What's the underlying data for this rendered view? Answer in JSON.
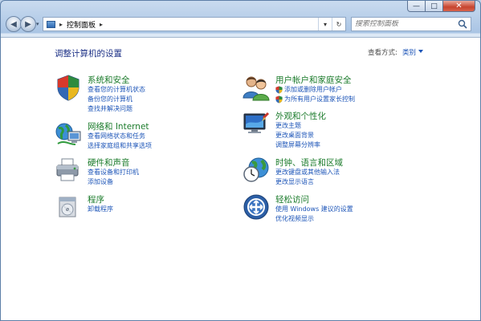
{
  "window": {
    "caption": {
      "minimize": "—",
      "maximize": "□",
      "close": "✕"
    }
  },
  "nav": {
    "back": "◀",
    "forward": "▶",
    "address_sep1": "▸",
    "address_text": "控制面板",
    "address_sep2": "▸",
    "dropdown": "▾",
    "refresh": "↻",
    "search_placeholder": "搜索控制面板"
  },
  "header": {
    "title": "调整计算机的设置",
    "view_by_label": "查看方式:",
    "view_by_value": "类别"
  },
  "categories": [
    {
      "title": "系统和安全",
      "icon": "security-shield-icon",
      "links": [
        "查看您的计算机状态",
        "备份您的计算机",
        "查找并解决问题"
      ]
    },
    {
      "title": "网络和 Internet",
      "icon": "network-globe-icon",
      "links": [
        "查看网络状态和任务",
        "选择家庭组和共享选项"
      ]
    },
    {
      "title": "硬件和声音",
      "icon": "printer-icon",
      "links": [
        "查看设备和打印机",
        "添加设备"
      ]
    },
    {
      "title": "程序",
      "icon": "programs-icon",
      "links": [
        "卸载程序"
      ]
    },
    {
      "title": "用户帐户和家庭安全",
      "icon": "users-icon",
      "links": [
        "添加或删除用户帐户",
        "为所有用户设置家长控制"
      ]
    },
    {
      "title": "外观和个性化",
      "icon": "monitor-icon",
      "links": [
        "更改主题",
        "更改桌面背景",
        "调整屏幕分辨率"
      ]
    },
    {
      "title": "时钟、语言和区域",
      "icon": "clock-globe-icon",
      "links": [
        "更改键盘或其他输入法",
        "更改显示语言"
      ]
    },
    {
      "title": "轻松访问",
      "icon": "ease-of-access-icon",
      "links": [
        "使用 Windows 建议的设置",
        "优化视频显示"
      ]
    }
  ],
  "colors": {
    "category_title": "#1b7b2b",
    "link": "#1e56b8",
    "heading": "#1e3287"
  }
}
